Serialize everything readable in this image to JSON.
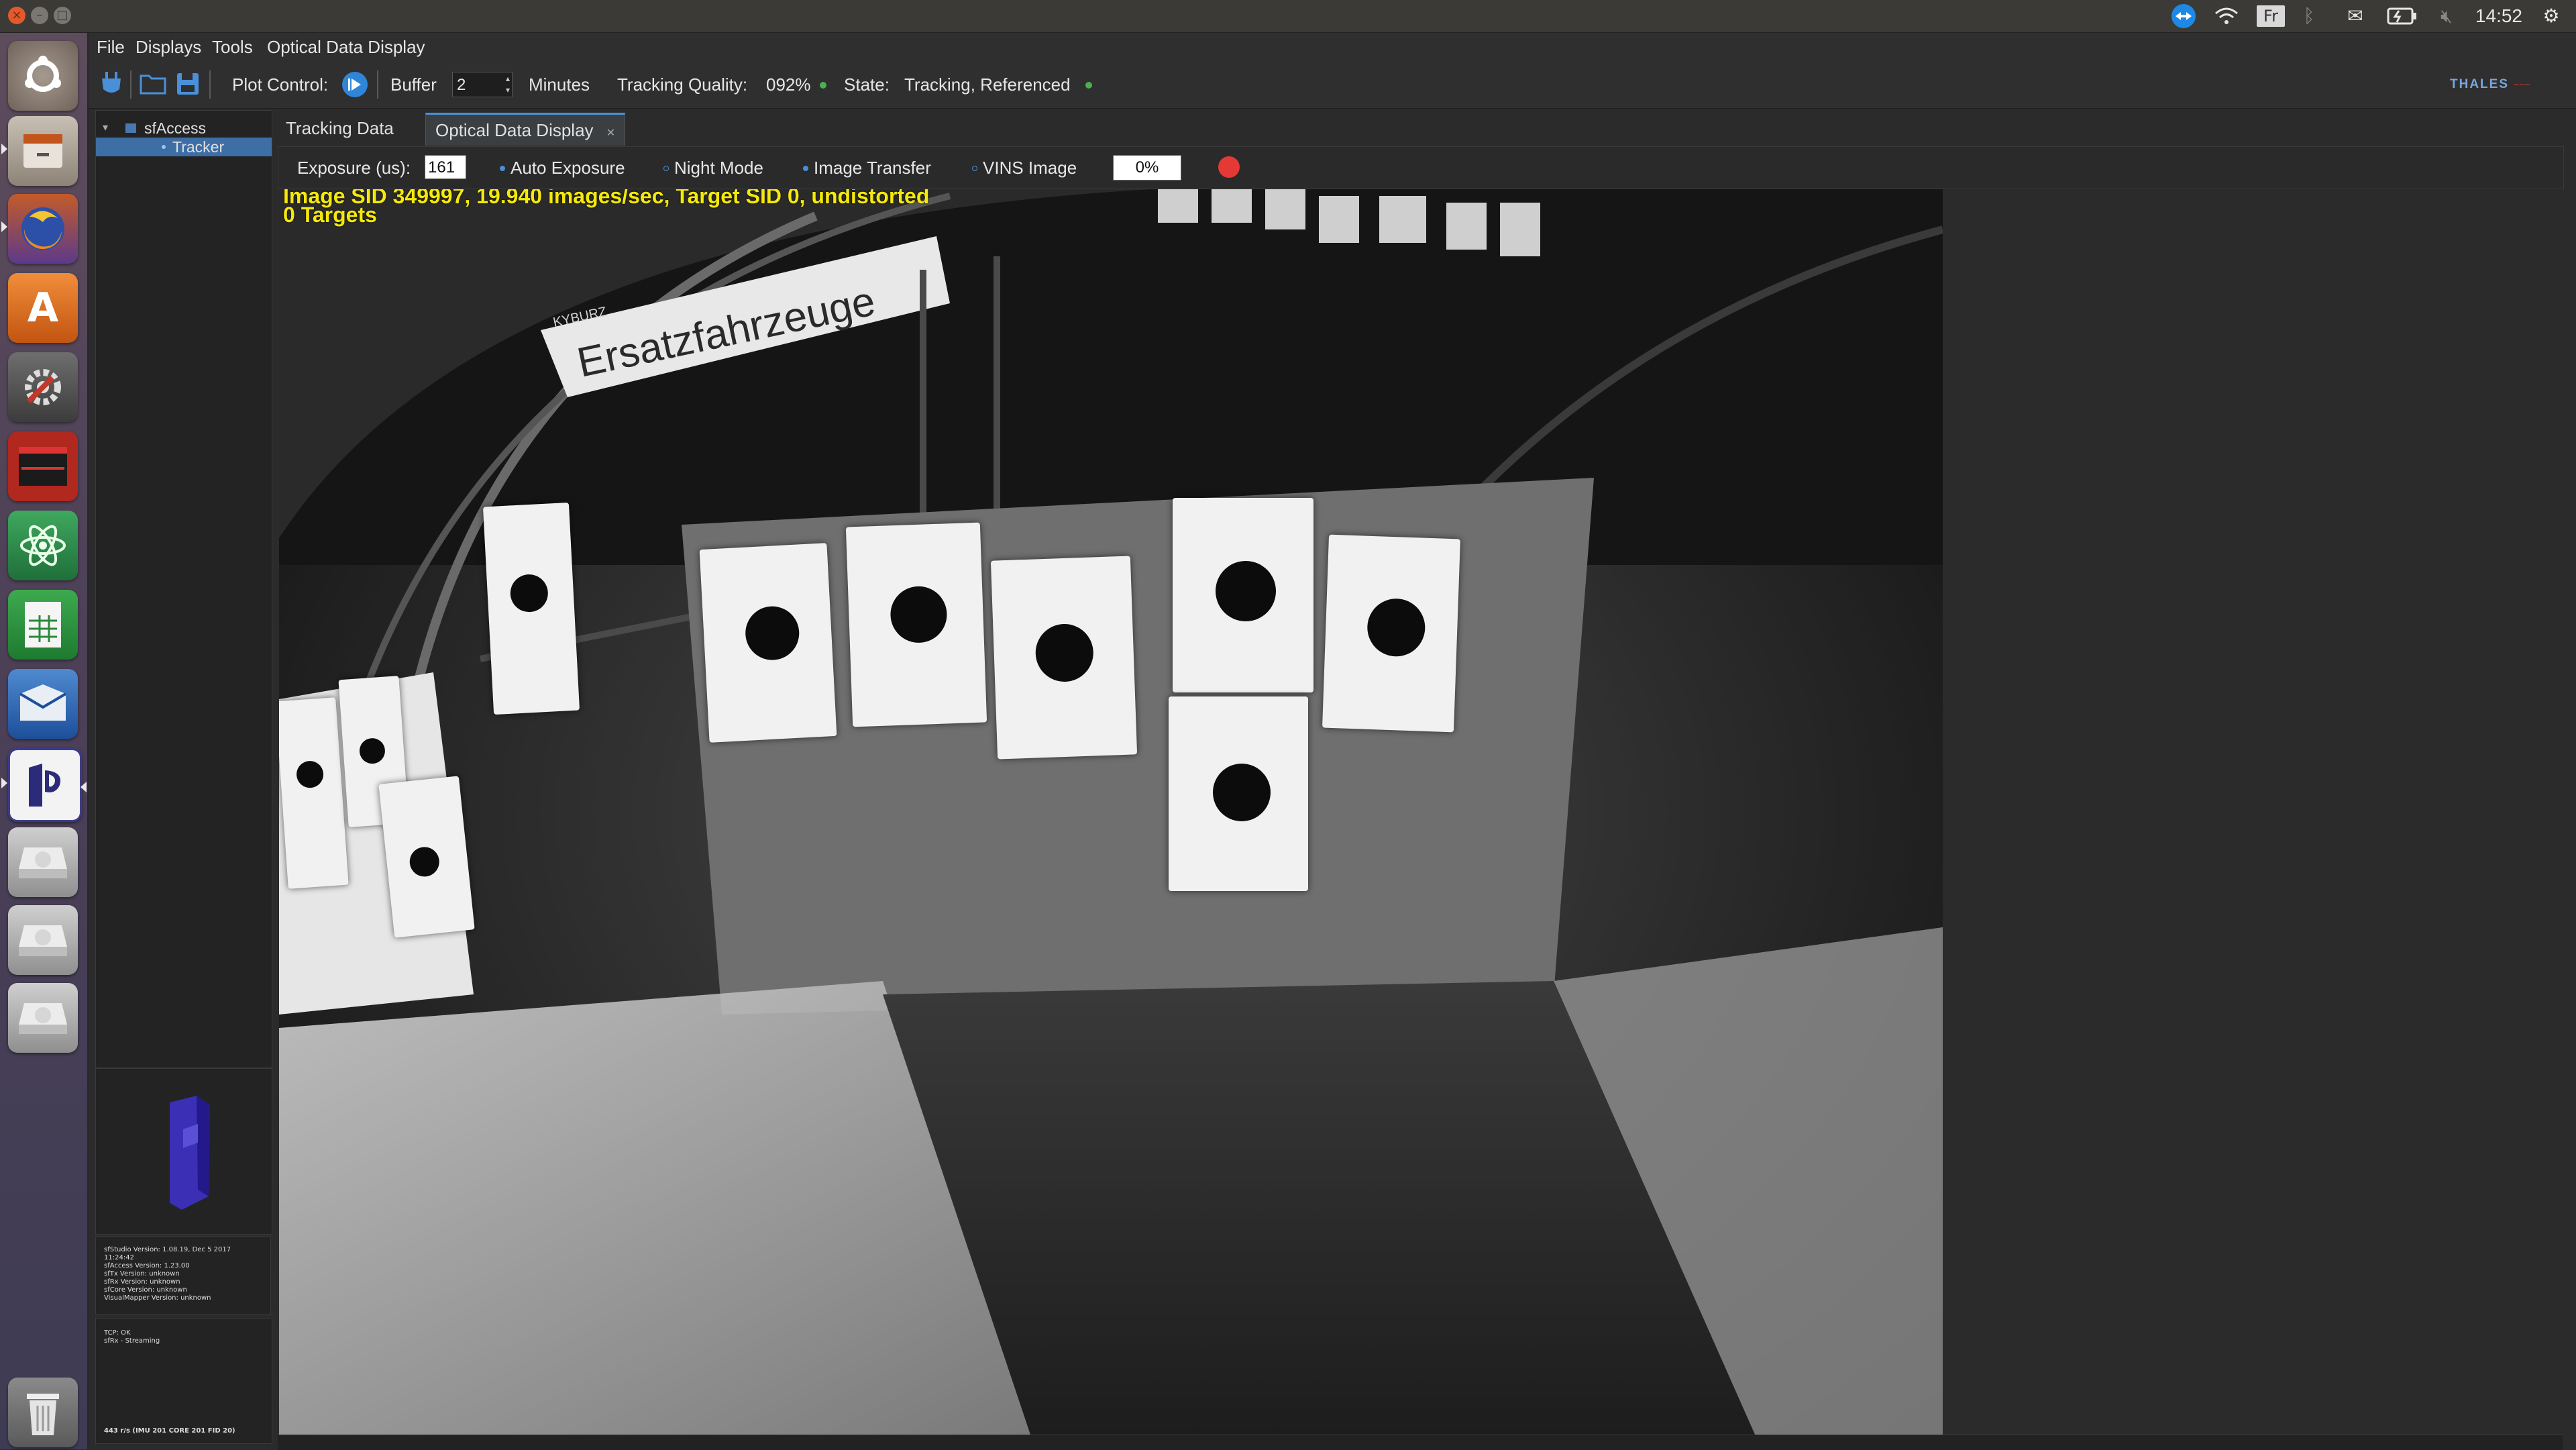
{
  "system": {
    "clock": "14:52",
    "keyboard_layout": "Fr"
  },
  "menu": [
    "File",
    "Displays",
    "Tools",
    "Optical Data Display"
  ],
  "toolbar": {
    "plot_control_label": "Plot Control:",
    "buffer_label": "Buffer",
    "buffer_value": "2",
    "buffer_unit": "Minutes",
    "tracking_quality_label": "Tracking Quality:",
    "tracking_quality_value": "092%",
    "state_label": "State:",
    "state_value": "Tracking, Referenced",
    "brand": "THALES"
  },
  "tree": {
    "root": "sfAccess",
    "child": "Tracker"
  },
  "tabs": [
    "Tracking Data",
    "Optical Data Display"
  ],
  "controls": {
    "exposure_label": "Exposure (us):",
    "exposure_value": "161",
    "auto_exposure": "Auto Exposure",
    "night_mode": "Night Mode",
    "image_transfer": "Image Transfer",
    "vins_image": "VINS Image",
    "progress": "0%"
  },
  "camera": {
    "overlay_line1": "Image SID 349997, 19.940 images/sec, Target SID 0, undistorted",
    "overlay_line2": "0 Targets",
    "sign_text": "Ersatzfahrzeuge",
    "sign_small": "KYBURZ"
  },
  "versions": {
    "studio": "sfStudio Version: 1.08.19, Dec  5 2017",
    "studio_time": "11:24:42",
    "access": "sfAccess Version: 1.23.00",
    "tx": "sfTx Version: unknown",
    "rx": "sfRx Version: unknown",
    "core": "sfCore Version: unknown",
    "mapper": "VisualMapper Version: unknown"
  },
  "connection": {
    "tcp": "TCP: OK",
    "rx": "sfRx - Streaming",
    "rate": "443 r/s (IMU 201  CORE 201  FID 20)"
  },
  "colors": {
    "accent": "#4a90d9",
    "status_ok": "#4caf50",
    "record": "#e53935",
    "overlay_text": "#f5e90a"
  }
}
